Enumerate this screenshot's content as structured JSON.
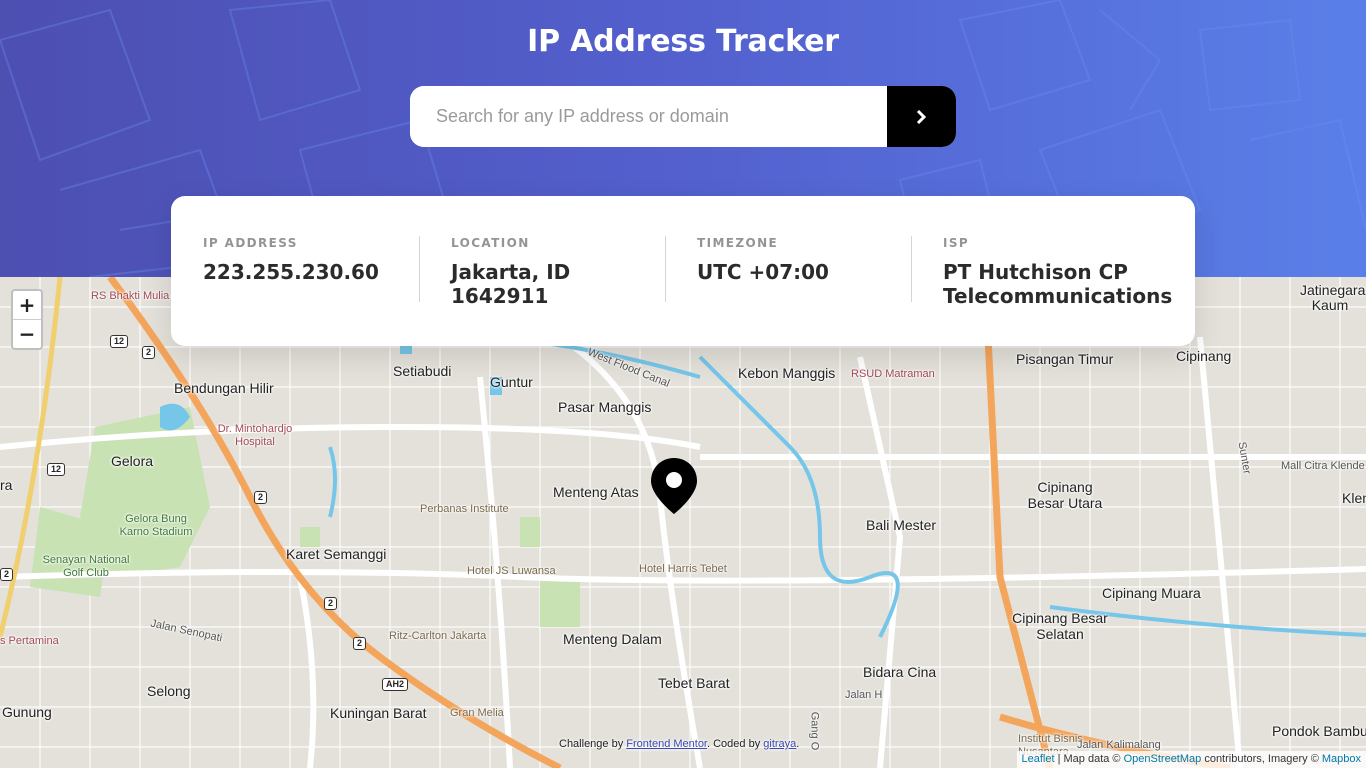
{
  "header": {
    "title": "IP Address Tracker",
    "search_placeholder": "Search for any IP address or domain",
    "search_value": ""
  },
  "info": [
    {
      "label": "IP ADDRESS",
      "value": "223.255.230.60"
    },
    {
      "label": "LOCATION",
      "value": "Jakarta, ID 1642911"
    },
    {
      "label": "TIMEZONE",
      "value": "UTC +07:00"
    },
    {
      "label": "ISP",
      "value": "PT Hutchison CP Telecommunications"
    }
  ],
  "map": {
    "zoom_in": "+",
    "zoom_out": "−",
    "labels": {
      "rs_bhakti": "RS Bhakti Mulia",
      "bendungan": "Bendungan Hilir",
      "setiabudi": "Setiabudi",
      "guntur": "Guntur",
      "west_flood": "West Flood Canal",
      "kebon": "Kebon Manggis",
      "rsud": "RSUD Matraman",
      "pisangan": "Pisangan Timur",
      "cipinang": "Cipinang",
      "jatinegara": "Jatinegara Kaum",
      "pasar": "Pasar Manggis",
      "mintohardjo": "Dr. Mintohardjo Hospital",
      "gelora": "Gelora",
      "menteng_atas": "Menteng Atas",
      "perbanas": "Perbanas Institute",
      "bali_mester": "Bali Mester",
      "cipinang_besar_utara": "Cipinang Besar Utara",
      "mall": "Mall Citra Klende",
      "gelora_bung": "Gelora Bung Karno Stadium",
      "senayan": "Senayan National Golf Club",
      "karet": "Karet Semanggi",
      "js_luwansa": "Hotel JS Luwansa",
      "harris": "Hotel Harris Tebet",
      "cipinang_muara": "Cipinang Muara",
      "pertamina": "s Pertamina",
      "jalan_senopati": "Jalan Senopati",
      "ritz": "Ritz-Carlton Jakarta",
      "menteng_dalam": "Menteng Dalam",
      "cipinang_besar_selatan": "Cipinang Besar Selatan",
      "selong": "Selong",
      "bidara": "Bidara Cina",
      "jalan_h": "Jalan H",
      "tebet_barat": "Tebet Barat",
      "gunung": "Gunung",
      "kuningan": "Kuningan Barat",
      "gran_melia": "Gran Melia",
      "gang": "Gang O",
      "institut": "Institut Bisnis Nusantara",
      "jalan_kalimalang": "Jalan Kalimalang",
      "pondok_bambu": "Pondok Bambu",
      "sunter": "Sunter",
      "klen": "Klen",
      "ra": "ra"
    },
    "shields": {
      "r12a": "12",
      "r2a": "2",
      "r12b": "12",
      "r2b": "2",
      "r2c": "2",
      "r2d": "2",
      "ah2": "AH2",
      "r2e": "2"
    }
  },
  "credit": {
    "prefix": "Challenge by",
    "fm": "Frontend Mentor",
    "mid": ". Coded by",
    "author": "gitraya",
    "suffix": "."
  },
  "attribution": {
    "leaflet": "Leaflet",
    "sep": " | Map data © ",
    "osm": "OpenStreetMap",
    "mid": " contributors, Imagery © ",
    "mapbox": "Mapbox"
  }
}
